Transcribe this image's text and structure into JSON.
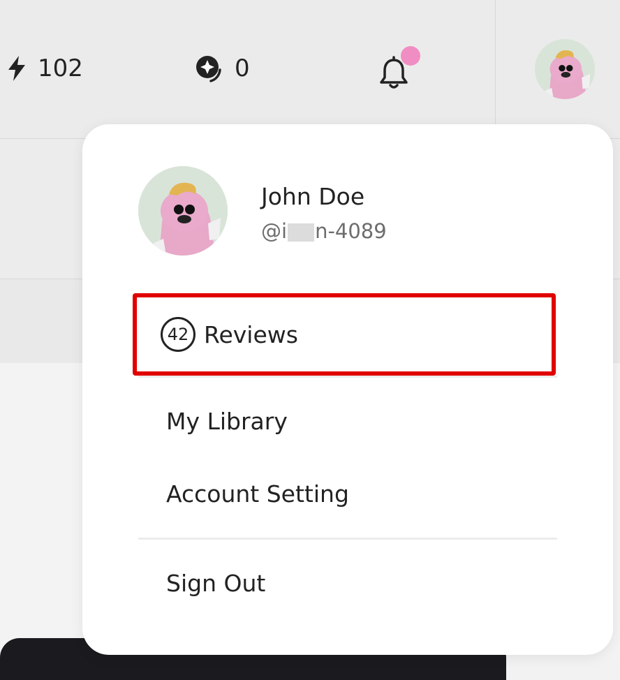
{
  "topbar": {
    "energy_value": "102",
    "coins_value": "0",
    "icons": {
      "energy": "lightning-bolt-icon",
      "coins": "compass-coin-icon",
      "notifications": "bell-icon",
      "notification_dot_color": "#f08ec3"
    }
  },
  "menu": {
    "user": {
      "name": "John Doe",
      "handle_prefix": "@i",
      "handle_suffix": "n-4089"
    },
    "reviews": {
      "count": "42",
      "label": "Reviews",
      "highlight_color": "#e10000"
    },
    "items": [
      {
        "label": "My Library"
      },
      {
        "label": "Account Setting"
      },
      {
        "label": "Sign Out"
      }
    ]
  }
}
